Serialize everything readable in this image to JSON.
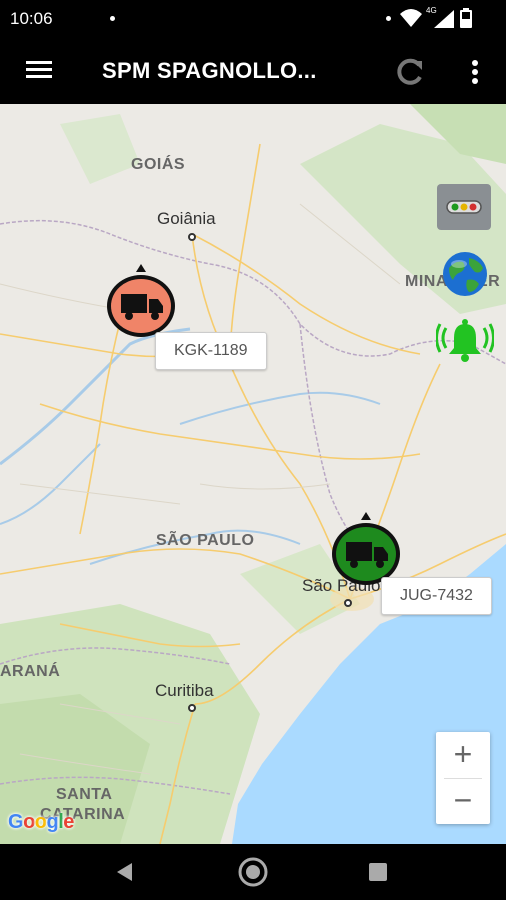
{
  "status_bar": {
    "time": "10:06",
    "network_label": "4G"
  },
  "app_bar": {
    "title": "SPM SPAGNOLLO...",
    "icons": {
      "menu": "hamburger-icon",
      "refresh": "refresh-icon",
      "more": "more-vert-icon"
    }
  },
  "map": {
    "regions": {
      "goias": "GOIÁS",
      "sao_paulo": "SÃO PAULO",
      "minas": "MINAS GER",
      "parana": "ARANÁ",
      "santa_catarina_1": "SANTA",
      "santa_catarina_2": "CATARINA"
    },
    "cities": {
      "goiania": "Goiânia",
      "sao_paulo": "São Paulo",
      "curitiba": "Curitiba"
    },
    "vehicles": [
      {
        "plate": "KGK-1189",
        "status_color": "#f08468"
      },
      {
        "plate": "JUG-7432",
        "status_color": "#1e8a1e"
      }
    ],
    "controls": {
      "traffic_icon": "traffic-light-icon",
      "globe_icon": "globe-icon",
      "alarm_icon": "bell-alarm-icon",
      "zoom_in": "+",
      "zoom_out": "−"
    },
    "attribution": "Google"
  },
  "nav_bar": {
    "back": "back-icon",
    "home": "home-icon",
    "recents": "recents-icon"
  }
}
